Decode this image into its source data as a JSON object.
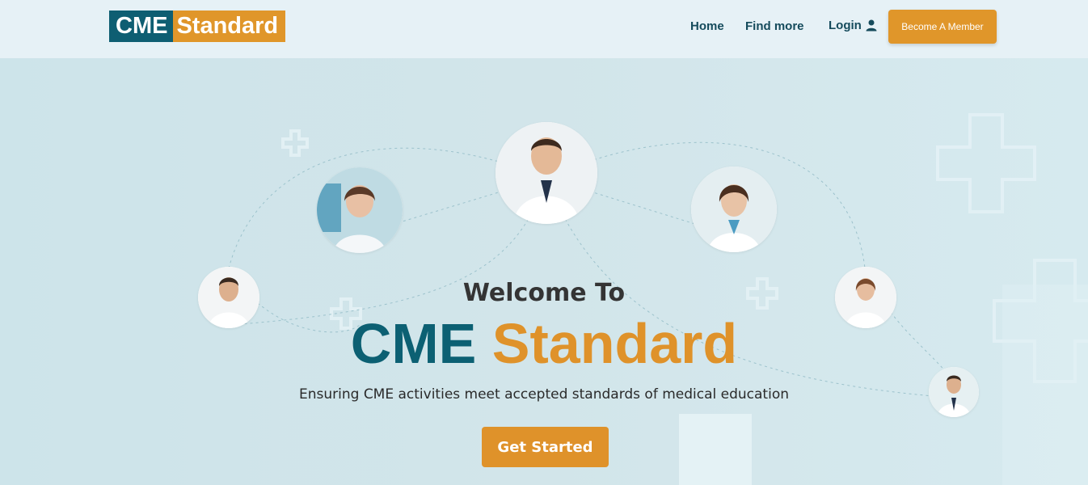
{
  "logo": {
    "part1": "CME",
    "part2": "Standard"
  },
  "nav": {
    "home": "Home",
    "find_more": "Find more",
    "login": "Login",
    "user_icon": "user-icon",
    "become_member": "Become A Member"
  },
  "hero": {
    "welcome": "Welcome To",
    "brand_part1": "CME",
    "brand_part2": "Standard",
    "tagline": "Ensuring CME activities meet accepted standards of medical education",
    "cta": "Get Started"
  },
  "colors": {
    "teal": "#0e5e72",
    "orange": "#e0962a",
    "nav_text": "#154b5c"
  }
}
